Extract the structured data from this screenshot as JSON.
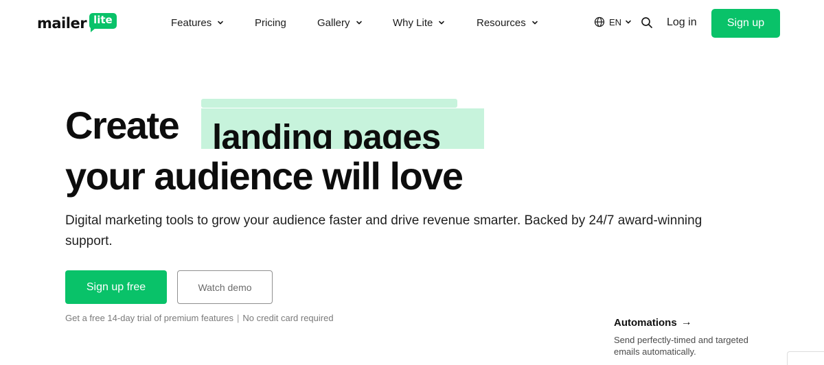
{
  "header": {
    "logo": {
      "word": "mailer",
      "badge": "lite"
    },
    "nav": [
      {
        "label": "Features",
        "has_dropdown": true
      },
      {
        "label": "Pricing",
        "has_dropdown": false
      },
      {
        "label": "Gallery",
        "has_dropdown": true
      },
      {
        "label": "Why Lite",
        "has_dropdown": true
      },
      {
        "label": "Resources",
        "has_dropdown": true
      }
    ],
    "language": "EN",
    "login_label": "Log in",
    "signup_label": "Sign up"
  },
  "hero": {
    "headline_start": "Create",
    "headline_rotating": "landing pages",
    "headline_end": "your audience will love",
    "subtitle": "Digital marketing tools to grow your audience faster and drive revenue smarter. Backed by 24/7 award-winning support.",
    "cta_primary": "Sign up free",
    "cta_secondary": "Watch demo",
    "trial_note_left": "Get a free 14-day trial of premium features",
    "trial_note_sep": "|",
    "trial_note_right": "No credit card required"
  },
  "feature_card": {
    "title": "Automations",
    "arrow": "→",
    "description": "Send perfectly-timed and targeted emails automatically."
  },
  "colors": {
    "brand_green": "#09c269",
    "highlight_green": "#c7f3dc",
    "text_dark": "#0d0d0d",
    "muted_text": "#7a7a7a"
  },
  "icons": {
    "language": "globe-icon",
    "search": "search-icon",
    "dropdown": "chevron-down-icon"
  }
}
